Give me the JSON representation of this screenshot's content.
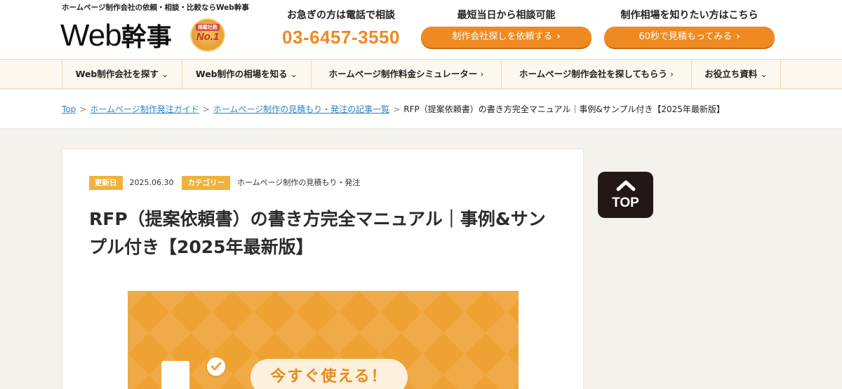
{
  "header": {
    "tagline": "ホームページ制作会社の依頼・相談・比較ならWeb幹事",
    "logo_latin": "Web",
    "logo_ja": "幹事",
    "badge_top": "掲載社数",
    "badge_main": "No.1",
    "phone_heading": "お急ぎの方は電話で相談",
    "phone_number": "03-6457-3550",
    "consult_heading": "最短当日から相談可能",
    "consult_button": "制作会社探しを依頼する",
    "price_heading": "制作相場を知りたい方はこちら",
    "price_button": "60秒で見積もってみる",
    "chevron": "›"
  },
  "nav": {
    "items": [
      {
        "label": "Web制作会社を探す",
        "arrow": "⌄"
      },
      {
        "label": "Web制作の相場を知る",
        "arrow": "⌄"
      },
      {
        "label": "ホームページ制作料金シミュレーター",
        "arrow": "›"
      },
      {
        "label": "ホームページ制作会社を探してもらう",
        "arrow": "›"
      },
      {
        "label": "お役立ち資料",
        "arrow": "⌄"
      }
    ]
  },
  "breadcrumb": {
    "items": [
      "Top",
      "ホームページ制作発注ガイド",
      "ホームページ制作の見積もり・発注の記事一覧"
    ],
    "current": "RFP（提案依頼書）の書き方完全マニュアル｜事例&サンプル付き【2025年最新版】",
    "separator": ">"
  },
  "article": {
    "updated_label": "更新日",
    "updated_value": "2025.06.30",
    "category_label": "カテゴリー",
    "category_value": "ホームページ制作の見積もり・発注",
    "title": "RFP（提案依頼書）の書き方完全マニュアル｜事例&サンプル付き【2025年最新版】",
    "hero_label": "今すぐ使える！"
  },
  "top_button": {
    "label": "TOP"
  },
  "colors": {
    "accent": "#ef8a22",
    "link": "#2f86c9",
    "pill": "#efb23a",
    "top_button": "#231815"
  }
}
